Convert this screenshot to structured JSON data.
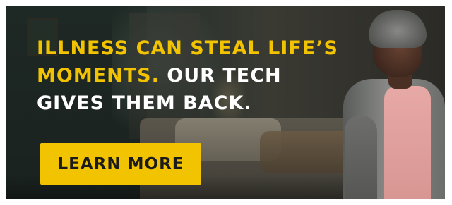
{
  "ad": {
    "headline": {
      "line1_yellow": "ILLNESS CAN STEAL LIFE’S",
      "line2_yellow": "MOMENTS.",
      "line2_white": " OUR TECH",
      "line3_white": "GIVES THEM BACK."
    },
    "cta_label": "LEARN MORE"
  },
  "colors": {
    "accent_yellow": "#f2c300",
    "headline_white": "#ffffff",
    "cta_text": "#1b1b1b"
  }
}
